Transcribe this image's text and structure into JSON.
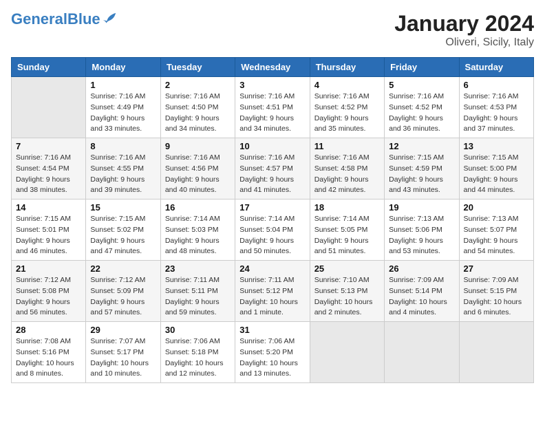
{
  "logo": {
    "part1": "General",
    "part2": "Blue"
  },
  "title": "January 2024",
  "subtitle": "Oliveri, Sicily, Italy",
  "days_header": [
    "Sunday",
    "Monday",
    "Tuesday",
    "Wednesday",
    "Thursday",
    "Friday",
    "Saturday"
  ],
  "weeks": [
    [
      {
        "day": "",
        "info": ""
      },
      {
        "day": "1",
        "info": "Sunrise: 7:16 AM\nSunset: 4:49 PM\nDaylight: 9 hours\nand 33 minutes."
      },
      {
        "day": "2",
        "info": "Sunrise: 7:16 AM\nSunset: 4:50 PM\nDaylight: 9 hours\nand 34 minutes."
      },
      {
        "day": "3",
        "info": "Sunrise: 7:16 AM\nSunset: 4:51 PM\nDaylight: 9 hours\nand 34 minutes."
      },
      {
        "day": "4",
        "info": "Sunrise: 7:16 AM\nSunset: 4:52 PM\nDaylight: 9 hours\nand 35 minutes."
      },
      {
        "day": "5",
        "info": "Sunrise: 7:16 AM\nSunset: 4:52 PM\nDaylight: 9 hours\nand 36 minutes."
      },
      {
        "day": "6",
        "info": "Sunrise: 7:16 AM\nSunset: 4:53 PM\nDaylight: 9 hours\nand 37 minutes."
      }
    ],
    [
      {
        "day": "7",
        "info": "Sunrise: 7:16 AM\nSunset: 4:54 PM\nDaylight: 9 hours\nand 38 minutes."
      },
      {
        "day": "8",
        "info": "Sunrise: 7:16 AM\nSunset: 4:55 PM\nDaylight: 9 hours\nand 39 minutes."
      },
      {
        "day": "9",
        "info": "Sunrise: 7:16 AM\nSunset: 4:56 PM\nDaylight: 9 hours\nand 40 minutes."
      },
      {
        "day": "10",
        "info": "Sunrise: 7:16 AM\nSunset: 4:57 PM\nDaylight: 9 hours\nand 41 minutes."
      },
      {
        "day": "11",
        "info": "Sunrise: 7:16 AM\nSunset: 4:58 PM\nDaylight: 9 hours\nand 42 minutes."
      },
      {
        "day": "12",
        "info": "Sunrise: 7:15 AM\nSunset: 4:59 PM\nDaylight: 9 hours\nand 43 minutes."
      },
      {
        "day": "13",
        "info": "Sunrise: 7:15 AM\nSunset: 5:00 PM\nDaylight: 9 hours\nand 44 minutes."
      }
    ],
    [
      {
        "day": "14",
        "info": "Sunrise: 7:15 AM\nSunset: 5:01 PM\nDaylight: 9 hours\nand 46 minutes."
      },
      {
        "day": "15",
        "info": "Sunrise: 7:15 AM\nSunset: 5:02 PM\nDaylight: 9 hours\nand 47 minutes."
      },
      {
        "day": "16",
        "info": "Sunrise: 7:14 AM\nSunset: 5:03 PM\nDaylight: 9 hours\nand 48 minutes."
      },
      {
        "day": "17",
        "info": "Sunrise: 7:14 AM\nSunset: 5:04 PM\nDaylight: 9 hours\nand 50 minutes."
      },
      {
        "day": "18",
        "info": "Sunrise: 7:14 AM\nSunset: 5:05 PM\nDaylight: 9 hours\nand 51 minutes."
      },
      {
        "day": "19",
        "info": "Sunrise: 7:13 AM\nSunset: 5:06 PM\nDaylight: 9 hours\nand 53 minutes."
      },
      {
        "day": "20",
        "info": "Sunrise: 7:13 AM\nSunset: 5:07 PM\nDaylight: 9 hours\nand 54 minutes."
      }
    ],
    [
      {
        "day": "21",
        "info": "Sunrise: 7:12 AM\nSunset: 5:08 PM\nDaylight: 9 hours\nand 56 minutes."
      },
      {
        "day": "22",
        "info": "Sunrise: 7:12 AM\nSunset: 5:09 PM\nDaylight: 9 hours\nand 57 minutes."
      },
      {
        "day": "23",
        "info": "Sunrise: 7:11 AM\nSunset: 5:11 PM\nDaylight: 9 hours\nand 59 minutes."
      },
      {
        "day": "24",
        "info": "Sunrise: 7:11 AM\nSunset: 5:12 PM\nDaylight: 10 hours\nand 1 minute."
      },
      {
        "day": "25",
        "info": "Sunrise: 7:10 AM\nSunset: 5:13 PM\nDaylight: 10 hours\nand 2 minutes."
      },
      {
        "day": "26",
        "info": "Sunrise: 7:09 AM\nSunset: 5:14 PM\nDaylight: 10 hours\nand 4 minutes."
      },
      {
        "day": "27",
        "info": "Sunrise: 7:09 AM\nSunset: 5:15 PM\nDaylight: 10 hours\nand 6 minutes."
      }
    ],
    [
      {
        "day": "28",
        "info": "Sunrise: 7:08 AM\nSunset: 5:16 PM\nDaylight: 10 hours\nand 8 minutes."
      },
      {
        "day": "29",
        "info": "Sunrise: 7:07 AM\nSunset: 5:17 PM\nDaylight: 10 hours\nand 10 minutes."
      },
      {
        "day": "30",
        "info": "Sunrise: 7:06 AM\nSunset: 5:18 PM\nDaylight: 10 hours\nand 12 minutes."
      },
      {
        "day": "31",
        "info": "Sunrise: 7:06 AM\nSunset: 5:20 PM\nDaylight: 10 hours\nand 13 minutes."
      },
      {
        "day": "",
        "info": ""
      },
      {
        "day": "",
        "info": ""
      },
      {
        "day": "",
        "info": ""
      }
    ]
  ]
}
